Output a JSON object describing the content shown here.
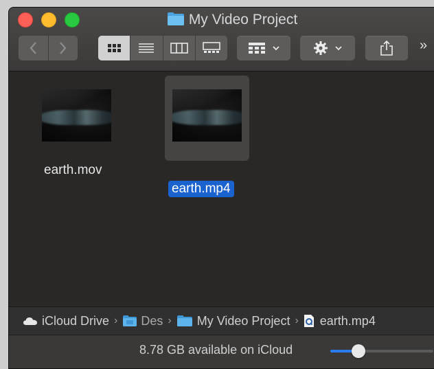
{
  "window": {
    "title": "My Video Project"
  },
  "toolbar": {
    "back_icon": "chevron-left-icon",
    "forward_icon": "chevron-right-icon",
    "view_modes": [
      "icon-view",
      "list-view",
      "column-view",
      "gallery-view"
    ],
    "active_view": "icon-view",
    "more_label": "»"
  },
  "files": [
    {
      "name": "earth.mov",
      "selected": false
    },
    {
      "name": "earth.mp4",
      "selected": true
    }
  ],
  "pathbar": {
    "items": [
      {
        "label": "iCloud Drive",
        "icon": "cloud-icon"
      },
      {
        "label": "Des",
        "icon": "folder-icon"
      },
      {
        "label": "My Video Project",
        "icon": "folder-icon"
      },
      {
        "label": "earth.mp4",
        "icon": "quicktime-file-icon"
      }
    ],
    "separator": "›"
  },
  "status": {
    "available": "8.78 GB available on iCloud",
    "icon_size_level": 0.27
  },
  "colors": {
    "selection": "#1a63cf",
    "accent": "#2b7bf0",
    "folder": "#4aa3df"
  }
}
